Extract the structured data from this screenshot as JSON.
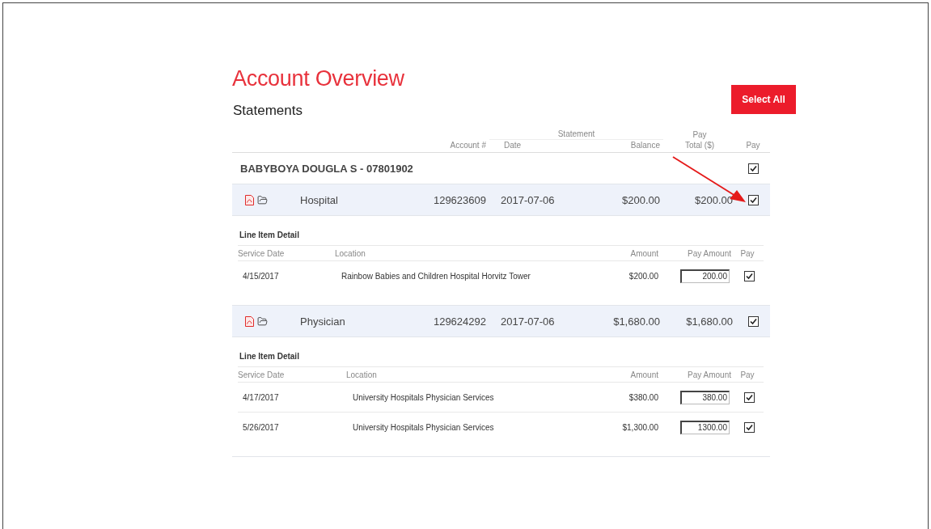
{
  "title": "Account Overview",
  "subtitle": "Statements",
  "select_all": "Select All",
  "columns": {
    "statement_group": "Statement",
    "pay_group": "Pay",
    "account": "Account #",
    "date": "Date",
    "balance": "Balance",
    "pay_total": "Total ($)",
    "pay": "Pay"
  },
  "account": {
    "name": "BABYBOYA DOUGLA S - 07801902",
    "checked": true
  },
  "statements": [
    {
      "type": "Hospital",
      "account": "129623609",
      "date": "2017-07-06",
      "balance": "$200.00",
      "pay_total": "$200.00",
      "checked": true,
      "detail": {
        "title": "Line Item Detail",
        "columns": [
          "Service Date",
          "Location",
          "Amount",
          "Pay Amount",
          "Pay"
        ],
        "rows": [
          {
            "service_date": "4/15/2017",
            "location": "Rainbow Babies and Children Hospital Horvitz Tower",
            "amount": "$200.00",
            "pay_amount": "200.00",
            "checked": true
          }
        ]
      }
    },
    {
      "type": "Physician",
      "account": "129624292",
      "date": "2017-07-06",
      "balance": "$1,680.00",
      "pay_total": "$1,680.00",
      "checked": true,
      "detail": {
        "title": "Line Item Detail",
        "columns": [
          "Service Date",
          "Location",
          "Amount",
          "Pay Amount",
          "Pay"
        ],
        "rows": [
          {
            "service_date": "4/17/2017",
            "location": "University Hospitals Physician Services",
            "amount": "$380.00",
            "pay_amount": "380.00",
            "checked": true
          },
          {
            "service_date": "5/26/2017",
            "location": "University Hospitals Physician Services",
            "amount": "$1,300.00",
            "pay_amount": "1300.00",
            "checked": true
          }
        ]
      }
    }
  ]
}
